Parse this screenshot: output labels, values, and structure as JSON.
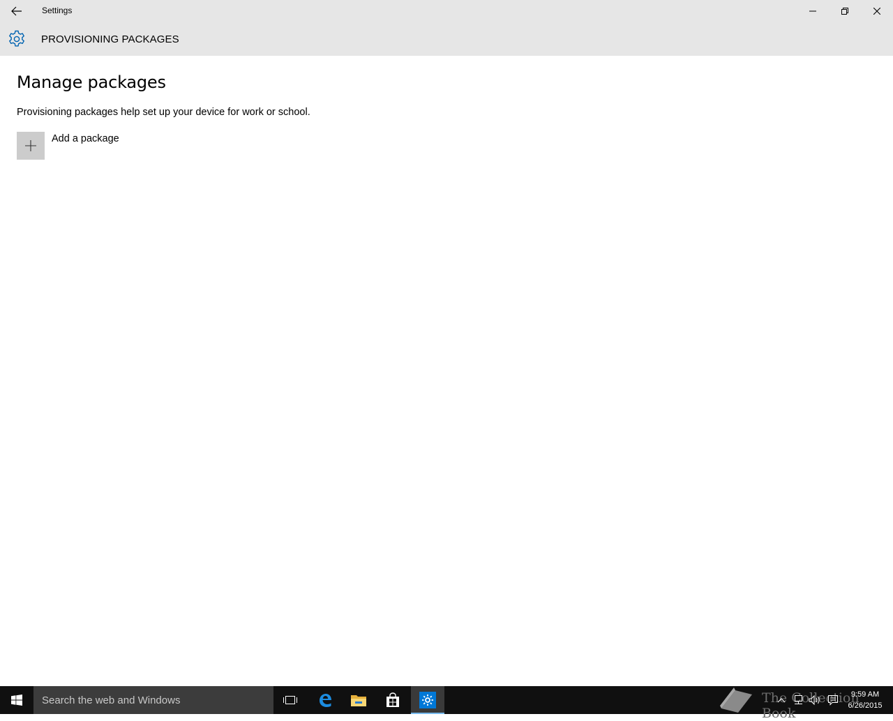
{
  "window": {
    "title": "Settings"
  },
  "header": {
    "title": "PROVISIONING PACKAGES",
    "icon": "gear-icon",
    "accent_color": "#0063b1"
  },
  "main": {
    "page_title": "Manage packages",
    "description": "Provisioning packages help set up your device for work or school.",
    "add_package_label": "Add a package"
  },
  "taskbar": {
    "search_placeholder": "Search the web and Windows",
    "apps": [
      "task-view-icon",
      "edge-icon",
      "file-explorer-icon",
      "store-icon",
      "settings-icon"
    ],
    "active_app": "settings-icon",
    "watermark_text": "The Collection Book",
    "clock_time": "9:59 AM",
    "clock_date": "6/26/2015"
  }
}
